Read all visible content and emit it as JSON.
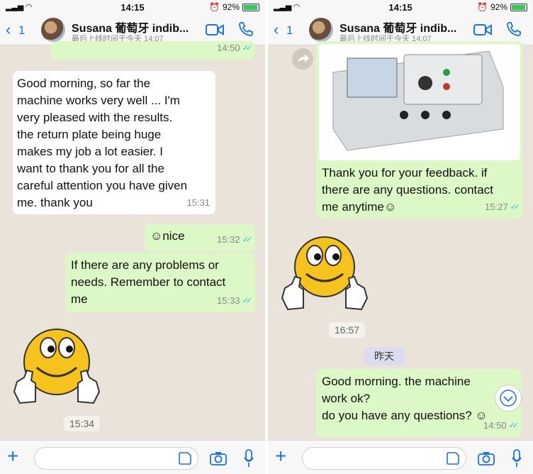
{
  "status": {
    "time": "14:15",
    "battery": "92%"
  },
  "header": {
    "back_count": "1",
    "contact_name": "Susana  葡萄牙  indib...",
    "last_seen": "最后上线时间于今天 14:07"
  },
  "left": {
    "top_bubble_time": "14:50",
    "msg1": {
      "lines": [
        "Good morning, so far the",
        "machine works very well ... I'm",
        "very pleased with the results.",
        "the return plate being huge",
        "makes my job a lot easier.  I",
        "want to thank you for all the",
        "careful attention you have given",
        "me.  thank you"
      ],
      "time": "15:31"
    },
    "msg2": {
      "text": "☺nice",
      "time": "15:32"
    },
    "msg3": {
      "lines": [
        "If there are any problems or",
        "needs. Remember to contact",
        "me"
      ],
      "time": "15:33"
    },
    "sticker_time": "15:34"
  },
  "right": {
    "msg1": {
      "lines": [
        "Thank you for your feedback. if",
        "there are any questions. contact",
        "me anytime☺"
      ],
      "time": "15:27"
    },
    "sticker_time": "16:57",
    "day_label": "昨天",
    "msg2": {
      "lines": [
        "Good morning.  the machine",
        "work ok?",
        "do you have any questions? ☺"
      ],
      "time": "14:50"
    }
  },
  "colors": {
    "outgoing": "#dcf8c6",
    "incoming": "#ffffff",
    "accent": "#1a73e8",
    "ticks": "#34b7f1"
  }
}
